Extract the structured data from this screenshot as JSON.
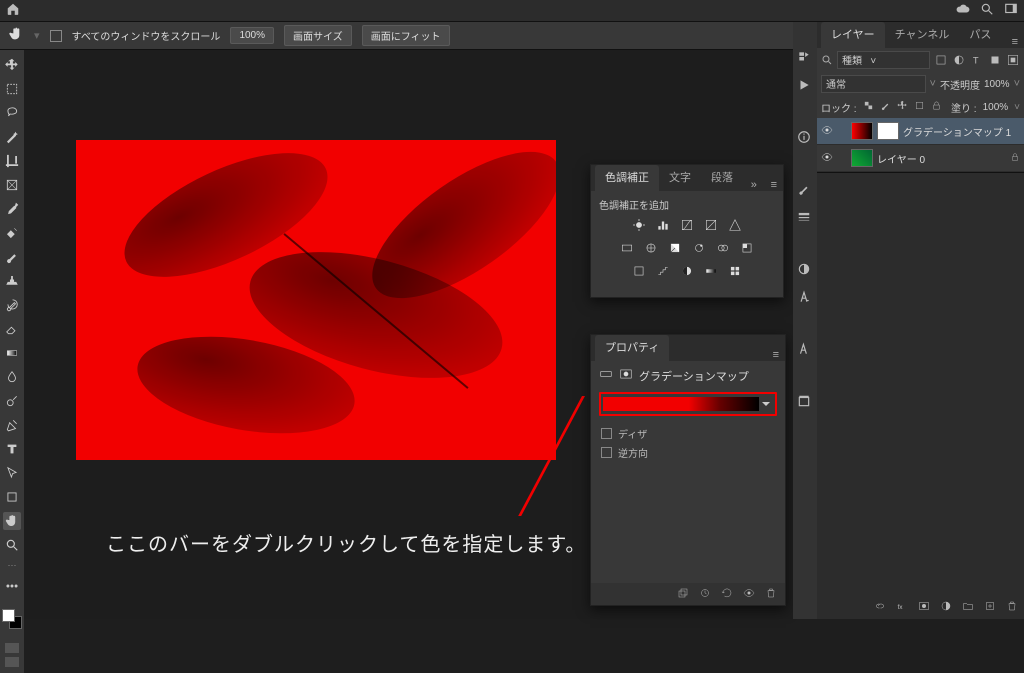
{
  "menubar": {},
  "optionbar": {
    "scroll_all_windows": "すべてのウィンドウをスクロール",
    "zoom_value": "100%",
    "fit_page": "画面サイズ",
    "fit_screen": "画面にフィット"
  },
  "adjustments": {
    "tabs": [
      "色調補正",
      "文字",
      "段落"
    ],
    "hint": "色調補正を追加"
  },
  "properties": {
    "tab": "プロパティ",
    "title": "グラデーションマップ",
    "dither": "ディザ",
    "reverse": "逆方向"
  },
  "layers_panel": {
    "tabs": [
      "レイヤー",
      "チャンネル",
      "パス"
    ],
    "filter_kind_label": "種類",
    "blend_mode_label": "通常",
    "opacity_label": "不透明度",
    "opacity_value": "100%",
    "lock_label": "ロック :",
    "fill_label": "塗り :",
    "fill_value": "100%",
    "layers": [
      {
        "name": "グラデーションマップ 1",
        "selected": true,
        "kind": "grad"
      },
      {
        "name": "レイヤー 0",
        "selected": false,
        "kind": "img",
        "locked": true
      }
    ]
  },
  "instruction": "ここのバーをダブルクリックして色を指定します。",
  "colors": {
    "accent_red": "#f20000"
  }
}
